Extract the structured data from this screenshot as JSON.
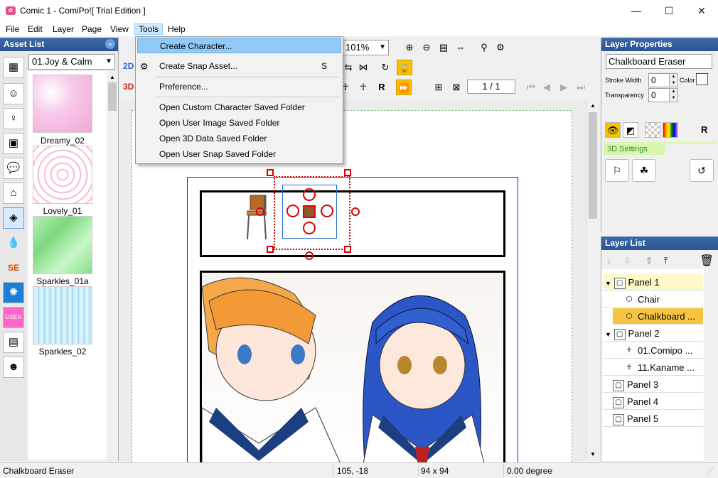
{
  "window": {
    "title": "Comic 1 - ComiPo![ Trial Edition ]",
    "minimize": "—",
    "maximize": "☐",
    "close": "✕"
  },
  "menubar": [
    "File",
    "Edit",
    "Layer",
    "Page",
    "View",
    "Tools",
    "Help"
  ],
  "asset_list": {
    "title": "Asset List",
    "category": "01.Joy & Calm",
    "items": [
      "Dreamy_02",
      "Lovely_01",
      "Sparkles_01a",
      "Sparkles_02"
    ]
  },
  "toolbar": {
    "zoom": "101%",
    "page": "1 / 1",
    "mode_2d": "2D",
    "mode_3d": "3D",
    "r_label": "R"
  },
  "tools_menu": {
    "items": [
      {
        "label": "Create Character...",
        "shortcut": ""
      },
      {
        "label": "Create Snap Asset...",
        "shortcut": "S"
      },
      {
        "label": "Preference...",
        "shortcut": ""
      },
      {
        "label": "Open Custom Character Saved Folder",
        "shortcut": ""
      },
      {
        "label": "Open User Image Saved Folder",
        "shortcut": ""
      },
      {
        "label": "Open 3D Data Saved Folder",
        "shortcut": ""
      },
      {
        "label": "Open User Snap Saved Folder",
        "shortcut": ""
      }
    ]
  },
  "layer_properties": {
    "title": "Layer Properties",
    "name": "Chalkboard Eraser",
    "stroke_width_label": "Stroke Width",
    "stroke_width": "0",
    "transparency_label": "Transparency",
    "transparency": "0",
    "color_label": "Color",
    "settings_3d": "3D Settings",
    "r_label": "R"
  },
  "layer_list": {
    "title": "Layer List",
    "rows": [
      {
        "label": "Panel 1",
        "indent": 0,
        "expand": "▼",
        "icon": "panel"
      },
      {
        "label": "Chair",
        "indent": 1,
        "expand": "",
        "icon": "cube"
      },
      {
        "label": "Chalkboard ...",
        "indent": 1,
        "expand": "",
        "icon": "cube"
      },
      {
        "label": "Panel 2",
        "indent": 0,
        "expand": "▼",
        "icon": "panel"
      },
      {
        "label": "01.Comipo ...",
        "indent": 1,
        "expand": "",
        "icon": "person"
      },
      {
        "label": "11.Kaname ...",
        "indent": 1,
        "expand": "",
        "icon": "person"
      },
      {
        "label": "Panel 3",
        "indent": 0,
        "expand": "",
        "icon": "panel"
      },
      {
        "label": "Panel 4",
        "indent": 0,
        "expand": "",
        "icon": "panel"
      },
      {
        "label": "Panel 5",
        "indent": 0,
        "expand": "",
        "icon": "panel"
      }
    ]
  },
  "status": {
    "name": "Chalkboard Eraser",
    "coords": "105, -18",
    "size": "94 x 94",
    "angle": "0.00 degree"
  }
}
